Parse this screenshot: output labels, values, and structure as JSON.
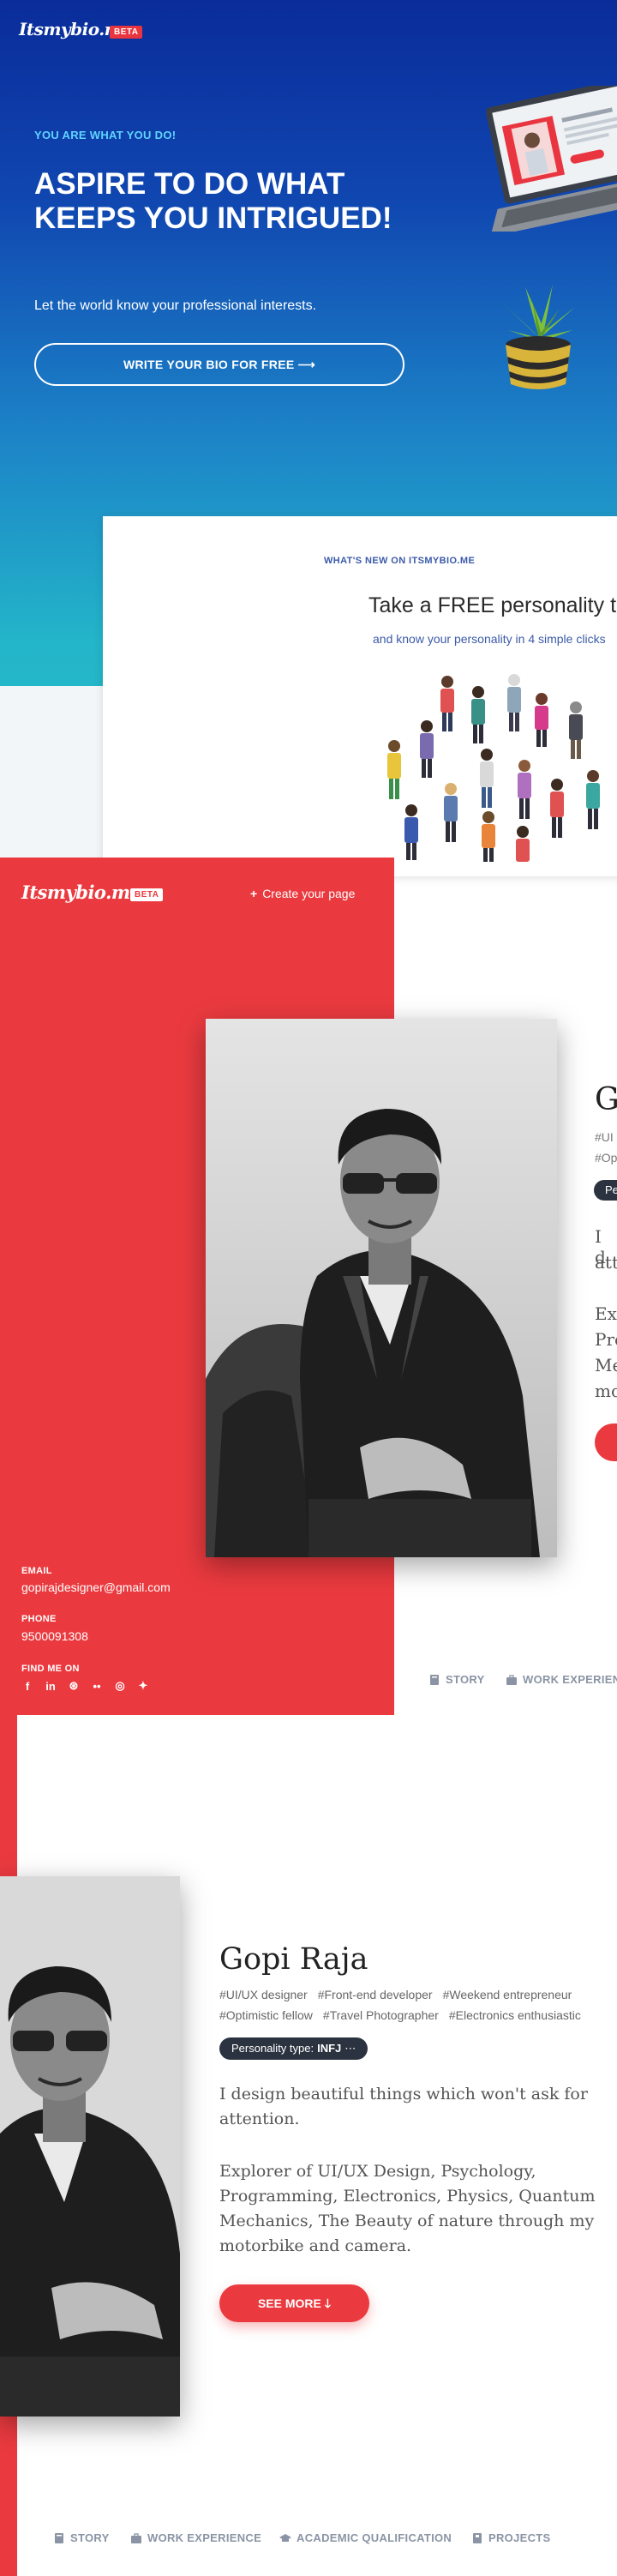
{
  "hero": {
    "logo": "Itsmybio.me",
    "beta": "BETA",
    "tagline": "YOU ARE WHAT YOU DO!",
    "headline": "ASPIRE TO DO WHAT KEEPS YOU INTRIGUED!",
    "subtext": "Let the world know your professional interests.",
    "cta": "WRITE YOUR BIO FOR FREE ⟶"
  },
  "news": {
    "label": "WHAT'S NEW ON ITSMYBIO.ME",
    "title": "Take a FREE personality tes",
    "subtitle": "and know your personality in 4 simple clicks"
  },
  "profile_header": {
    "logo": "Itsmybio.me",
    "beta": "BETA",
    "create_page": "Create your page"
  },
  "profile_preview": {
    "name_fragment": "G",
    "hash_fragments": [
      "#UI",
      "#Op"
    ],
    "pill_fragment": "Pe",
    "body_fragments": [
      "I d",
      "att",
      "Ex",
      "Pro",
      "Me",
      "mo"
    ]
  },
  "contact": {
    "email_label": "EMAIL",
    "email": "gopirajdesigner@gmail.com",
    "phone_label": "PHONE",
    "phone": "9500091308",
    "social_label": "FIND ME ON",
    "social": [
      {
        "icon": "facebook-icon",
        "glyph": "f"
      },
      {
        "icon": "linkedin-icon",
        "glyph": "in"
      },
      {
        "icon": "dribbble-icon",
        "glyph": "⊛"
      },
      {
        "icon": "flickr-icon",
        "glyph": "••"
      },
      {
        "icon": "instagram-icon",
        "glyph": "◎"
      },
      {
        "icon": "twitter-icon",
        "glyph": "✦"
      }
    ]
  },
  "tabs_preview": [
    "STORY",
    "WORK EXPERIENC"
  ],
  "profile": {
    "name": "Gopi Raja",
    "hashtags_row1": [
      "#UI/UX designer",
      "#Front-end developer",
      "#Weekend entrepreneur"
    ],
    "hashtags_row2": [
      "#Optimistic fellow",
      "#Travel Photographer",
      "#Electronics enthusiastic"
    ],
    "personality_label": "Personality type:",
    "personality_type": "INFJ",
    "personality_more": "⋯",
    "bio_intro": "I design beautiful things which won't ask for attention.",
    "bio_more": "Explorer of UI/UX Design, Psychology, Programming, Electronics, Physics, Quantum Mechanics, The Beauty of nature through my motorbike and camera.",
    "see_more": "SEE MORE 🡓"
  },
  "tabs": [
    "STORY",
    "WORK EXPERIENCE",
    "ACADEMIC QUALIFICATION",
    "PROJECTS"
  ],
  "colors": {
    "brand_red": "#ea3a3f",
    "hero_blue": "#0a2c9a",
    "hero_teal": "#2bb8c8",
    "dark_pill": "#2c3340"
  }
}
